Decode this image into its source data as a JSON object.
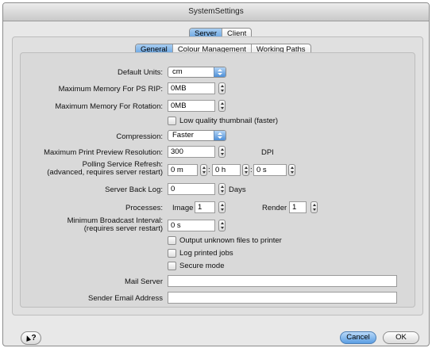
{
  "window": {
    "title": "SystemSettings"
  },
  "top_tabs": [
    {
      "label": "Server",
      "active": true
    },
    {
      "label": "Client",
      "active": false
    }
  ],
  "sub_tabs": [
    {
      "label": "General",
      "active": true
    },
    {
      "label": "Colour Management",
      "active": false
    },
    {
      "label": "Working Paths",
      "active": false
    }
  ],
  "form": {
    "default_units": {
      "label": "Default Units:",
      "value": "cm"
    },
    "max_memory_ps_rip": {
      "label": "Maximum Memory For PS RIP:",
      "value": "0MB"
    },
    "max_memory_rotation": {
      "label": "Maximum Memory For Rotation:",
      "value": "0MB"
    },
    "low_quality_thumbnail": {
      "label": "Low quality thumbnail (faster)",
      "checked": false
    },
    "compression": {
      "label": "Compression:",
      "value": "Faster"
    },
    "max_preview_resolution": {
      "label": "Maximum Print Preview Resolution:",
      "value": "300",
      "unit": "DPI"
    },
    "polling_refresh": {
      "label_line1": "Polling Service Refresh:",
      "label_line2": "(advanced, requires server restart)",
      "minutes": "0 m",
      "hours": "0 h",
      "seconds": "0 s",
      "sep1": ":",
      "sep2": ":"
    },
    "server_back_log": {
      "label": "Server Back Log:",
      "value": "0",
      "unit": "Days"
    },
    "processes": {
      "label": "Processes:",
      "image_label": "Image",
      "image_value": "1",
      "render_label": "Render",
      "render_value": "1"
    },
    "min_broadcast_interval": {
      "label_line1": "Minimum Broadcast Interval:",
      "label_line2": "(requires server restart)",
      "value": "0 s"
    },
    "output_unknown_files": {
      "label": "Output unknown files to printer",
      "checked": false
    },
    "log_printed_jobs": {
      "label": "Log printed jobs",
      "checked": false
    },
    "secure_mode": {
      "label": "Secure mode",
      "checked": false
    },
    "mail_server": {
      "label": "Mail Server",
      "value": ""
    },
    "sender_email": {
      "label": "Sender Email Address",
      "value": ""
    }
  },
  "footer": {
    "help_label": "?",
    "cancel_label": "Cancel",
    "ok_label": "OK"
  }
}
